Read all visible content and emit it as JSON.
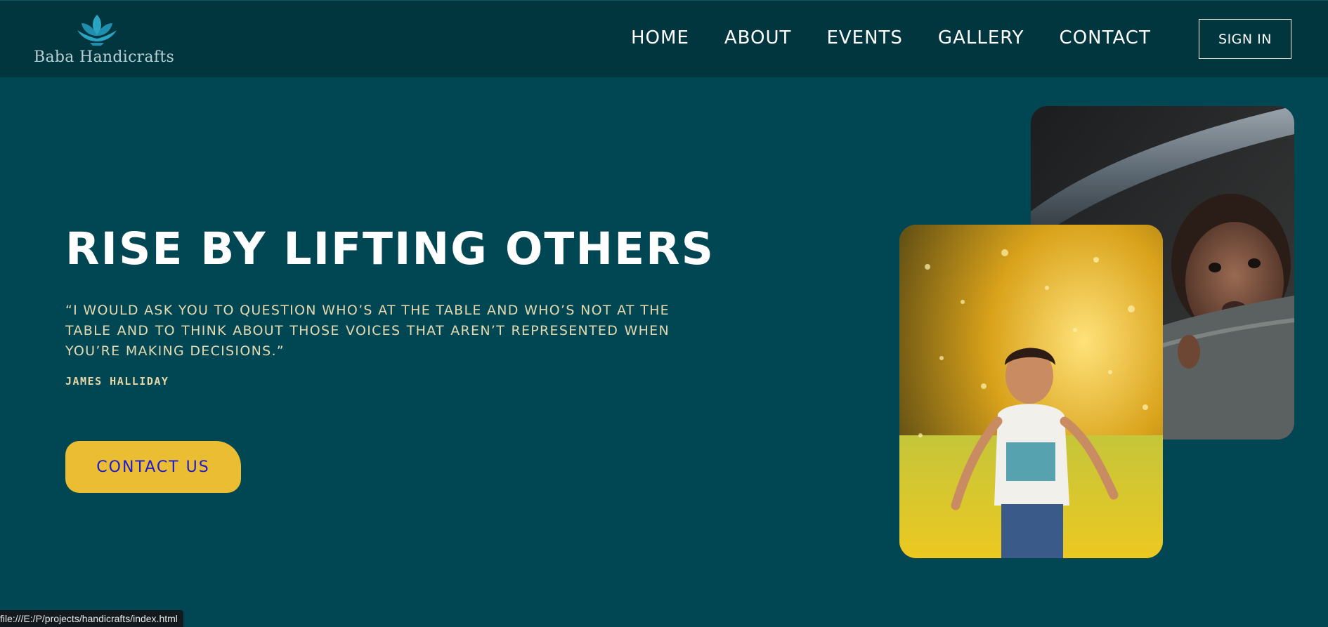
{
  "header": {
    "brand_name": "Baba Handicrafts",
    "logo_icon": "lotus-icon",
    "nav": [
      "HOME",
      "ABOUT",
      "EVENTS",
      "GALLERY",
      "CONTACT"
    ],
    "sign_in_label": "SIGN IN"
  },
  "hero": {
    "title": "RISE BY LIFTING OTHERS",
    "quote": "“I WOULD ASK YOU TO QUESTION WHO’S AT THE TABLE AND WHO’S NOT AT THE TABLE AND TO THINK ABOUT THOSE VOICES THAT AREN’T REPRESENTED WHEN YOU’RE MAKING DECISIONS.”",
    "author": "JAMES HALLIDAY",
    "cta_label": "CONTACT US"
  },
  "photos": {
    "back": "child-in-vehicle-photo",
    "front": "child-running-in-water-photo"
  },
  "statusbar": {
    "url": "file:///E:/P/projects/handicrafts/index.html"
  },
  "colors": {
    "background": "#014753",
    "header": "#01363f",
    "accent": "#ebbd32",
    "cta_text": "#1e1ad0",
    "quote_text": "#e5d9b0"
  }
}
